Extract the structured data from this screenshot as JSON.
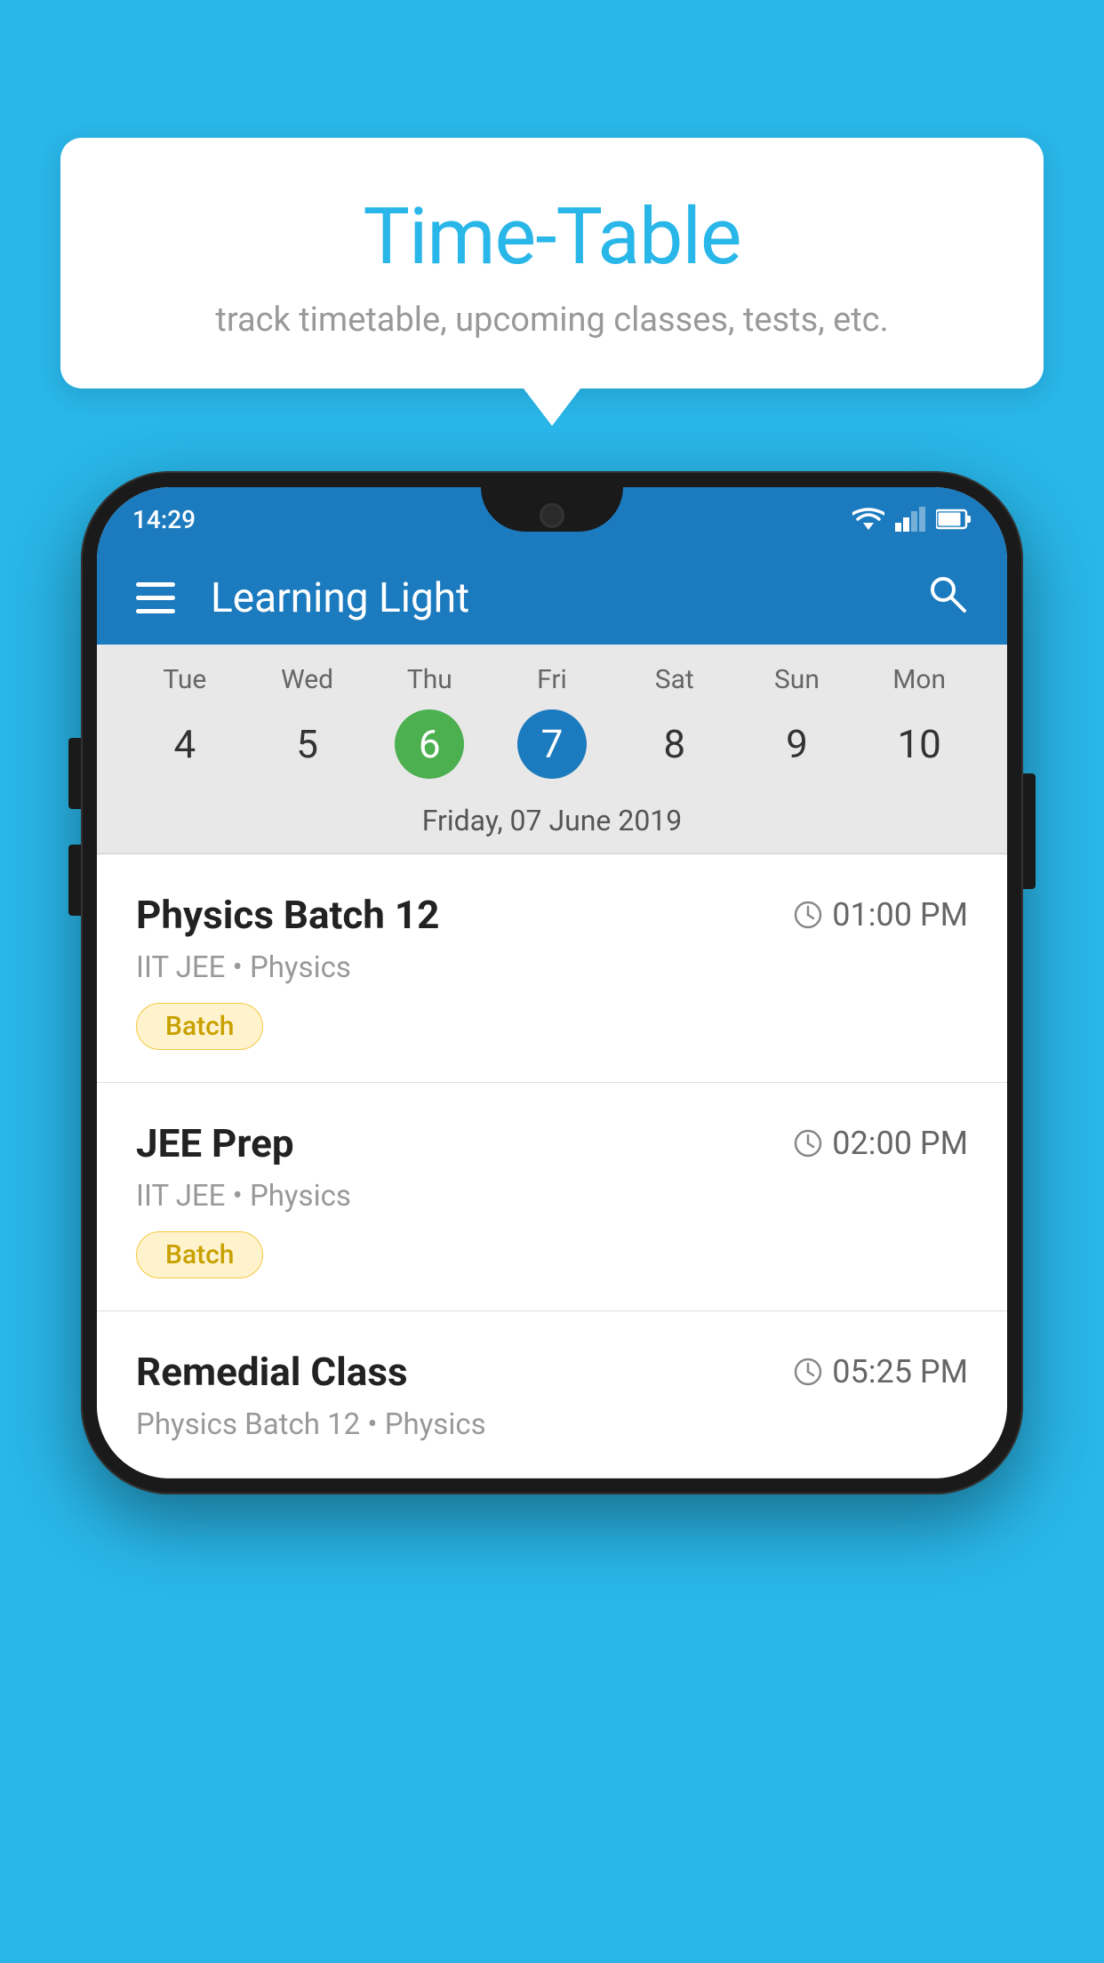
{
  "background": {
    "color": "#29b6e8"
  },
  "tooltip": {
    "title": "Time-Table",
    "subtitle": "track timetable, upcoming classes, tests, etc."
  },
  "status_bar": {
    "time": "14:29"
  },
  "app_bar": {
    "title": "Learning Light"
  },
  "calendar": {
    "days": [
      {
        "name": "Tue",
        "num": "4",
        "state": "normal"
      },
      {
        "name": "Wed",
        "num": "5",
        "state": "normal"
      },
      {
        "name": "Thu",
        "num": "6",
        "state": "today"
      },
      {
        "name": "Fri",
        "num": "7",
        "state": "selected"
      },
      {
        "name": "Sat",
        "num": "8",
        "state": "normal"
      },
      {
        "name": "Sun",
        "num": "9",
        "state": "normal"
      },
      {
        "name": "Mon",
        "num": "10",
        "state": "normal"
      }
    ],
    "selected_date_label": "Friday, 07 June 2019"
  },
  "classes": [
    {
      "name": "Physics Batch 12",
      "time": "01:00 PM",
      "meta": "IIT JEE • Physics",
      "badge": "Batch"
    },
    {
      "name": "JEE Prep",
      "time": "02:00 PM",
      "meta": "IIT JEE • Physics",
      "badge": "Batch"
    },
    {
      "name": "Remedial Class",
      "time": "05:25 PM",
      "meta": "Physics Batch 12 • Physics",
      "badge": null
    }
  ]
}
